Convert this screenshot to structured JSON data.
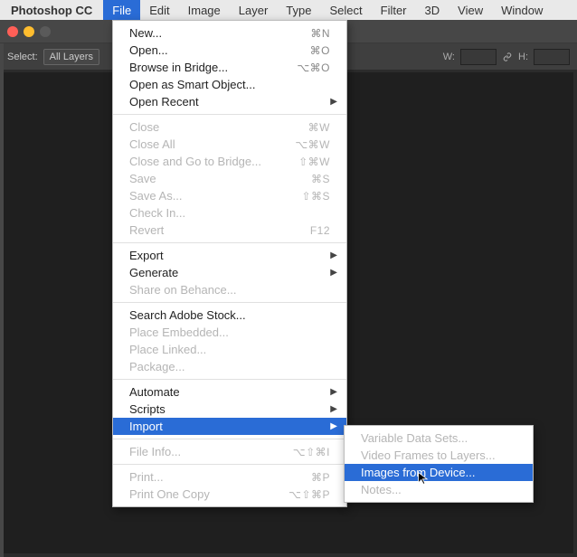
{
  "menubar": {
    "app": "Photoshop CC",
    "items": [
      "File",
      "Edit",
      "Image",
      "Layer",
      "Type",
      "Select",
      "Filter",
      "3D",
      "View",
      "Window"
    ],
    "active_index": 0
  },
  "traffic_colors": {
    "close": "#ff5f57",
    "min": "#ffbd2e",
    "zoom": "#5a5a5a"
  },
  "toolbar": {
    "select_label": "Select:",
    "select_value": "All Layers",
    "w_label": "W:",
    "h_label": "H:"
  },
  "file_menu": [
    {
      "type": "item",
      "label": "New...",
      "shortcut": "⌘N"
    },
    {
      "type": "item",
      "label": "Open...",
      "shortcut": "⌘O"
    },
    {
      "type": "item",
      "label": "Browse in Bridge...",
      "shortcut": "⌥⌘O"
    },
    {
      "type": "item",
      "label": "Open as Smart Object..."
    },
    {
      "type": "item",
      "label": "Open Recent",
      "submenu": true
    },
    {
      "type": "sep"
    },
    {
      "type": "item",
      "label": "Close",
      "shortcut": "⌘W",
      "disabled": true
    },
    {
      "type": "item",
      "label": "Close All",
      "shortcut": "⌥⌘W",
      "disabled": true
    },
    {
      "type": "item",
      "label": "Close and Go to Bridge...",
      "shortcut": "⇧⌘W",
      "disabled": true
    },
    {
      "type": "item",
      "label": "Save",
      "shortcut": "⌘S",
      "disabled": true
    },
    {
      "type": "item",
      "label": "Save As...",
      "shortcut": "⇧⌘S",
      "disabled": true
    },
    {
      "type": "item",
      "label": "Check In...",
      "disabled": true
    },
    {
      "type": "item",
      "label": "Revert",
      "shortcut": "F12",
      "disabled": true
    },
    {
      "type": "sep"
    },
    {
      "type": "item",
      "label": "Export",
      "submenu": true
    },
    {
      "type": "item",
      "label": "Generate",
      "submenu": true
    },
    {
      "type": "item",
      "label": "Share on Behance...",
      "disabled": true
    },
    {
      "type": "sep"
    },
    {
      "type": "item",
      "label": "Search Adobe Stock..."
    },
    {
      "type": "item",
      "label": "Place Embedded...",
      "disabled": true
    },
    {
      "type": "item",
      "label": "Place Linked...",
      "disabled": true
    },
    {
      "type": "item",
      "label": "Package...",
      "disabled": true
    },
    {
      "type": "sep"
    },
    {
      "type": "item",
      "label": "Automate",
      "submenu": true
    },
    {
      "type": "item",
      "label": "Scripts",
      "submenu": true
    },
    {
      "type": "item",
      "label": "Import",
      "submenu": true,
      "highlight": true
    },
    {
      "type": "sep"
    },
    {
      "type": "item",
      "label": "File Info...",
      "shortcut": "⌥⇧⌘I",
      "disabled": true
    },
    {
      "type": "sep"
    },
    {
      "type": "item",
      "label": "Print...",
      "shortcut": "⌘P",
      "disabled": true
    },
    {
      "type": "item",
      "label": "Print One Copy",
      "shortcut": "⌥⇧⌘P",
      "disabled": true
    }
  ],
  "import_submenu": [
    {
      "label": "Variable Data Sets...",
      "disabled": true
    },
    {
      "label": "Video Frames to Layers...",
      "disabled": true
    },
    {
      "label": "Images from Device...",
      "highlight": true
    },
    {
      "label": "Notes...",
      "disabled": true
    }
  ]
}
